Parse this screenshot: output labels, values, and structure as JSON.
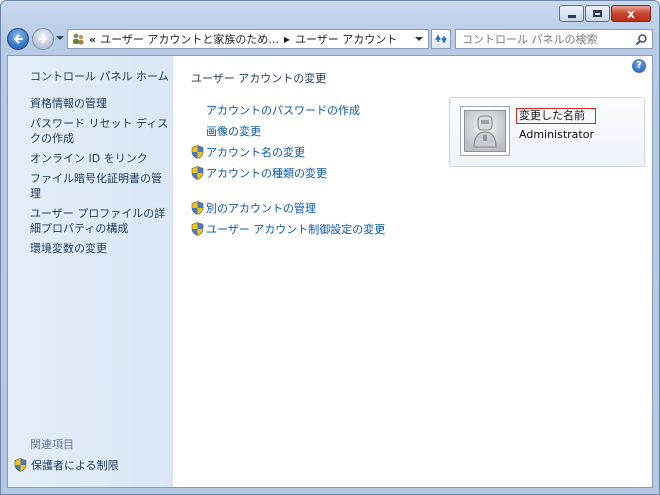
{
  "window": {
    "caption_buttons": {
      "minimize": "minimize",
      "maximize": "maximize",
      "close": "x"
    }
  },
  "nav": {
    "address": {
      "overflow": "«",
      "crumbs": [
        "ユーザー アカウントと家族のため...",
        "ユーザー アカウント"
      ]
    },
    "search_placeholder": "コントロール パネルの検索"
  },
  "sidebar": {
    "home": "コントロール パネル ホーム",
    "links": [
      "資格情報の管理",
      "パスワード リセット ディスクの作成",
      "オンライン ID をリンク",
      "ファイル暗号化証明書の管理",
      "ユーザー プロファイルの詳細プロパティの構成",
      "環境変数の変更"
    ],
    "related_heading": "関連項目",
    "parental_controls": "保護者による制限"
  },
  "main": {
    "title": "ユーザー アカウントの変更",
    "tasks": [
      {
        "label": "アカウントのパスワードの作成",
        "shield": false
      },
      {
        "label": "画像の変更",
        "shield": false
      },
      {
        "label": "アカウント名の変更",
        "shield": true
      },
      {
        "label": "アカウントの種類の変更",
        "shield": true
      }
    ],
    "admin_tasks": [
      {
        "label": "別のアカウントの管理",
        "shield": true
      },
      {
        "label": "ユーザー アカウント制御設定の変更",
        "shield": true
      }
    ],
    "account": {
      "name": "変更した名前",
      "role": "Administrator"
    },
    "help_icon": "?"
  },
  "colors": {
    "link": "#0c57b0",
    "heading": "#1e395b",
    "highlight_border": "#d2281e",
    "sidebar_bg": "#dbe7f6"
  }
}
